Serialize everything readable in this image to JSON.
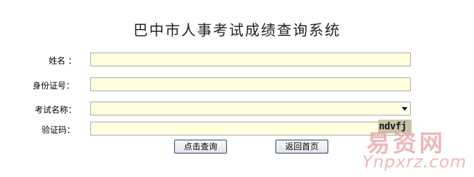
{
  "title": "巴中市人事考试成绩查询系统",
  "form": {
    "name_label": "姓名 ：",
    "name_value": "",
    "id_label": "身份证号：",
    "id_value": "",
    "exam_label": "考试名称：",
    "exam_selected": "",
    "captcha_label": "验证码：",
    "captcha_value": "",
    "captcha_image_text": "ndvfj"
  },
  "buttons": {
    "query": "点击查询",
    "home": "返回首页"
  },
  "watermark": {
    "top": "易资网",
    "bottom": "Ynpxrz.com"
  },
  "icons": {
    "dropdown": "chevron-down-icon"
  }
}
